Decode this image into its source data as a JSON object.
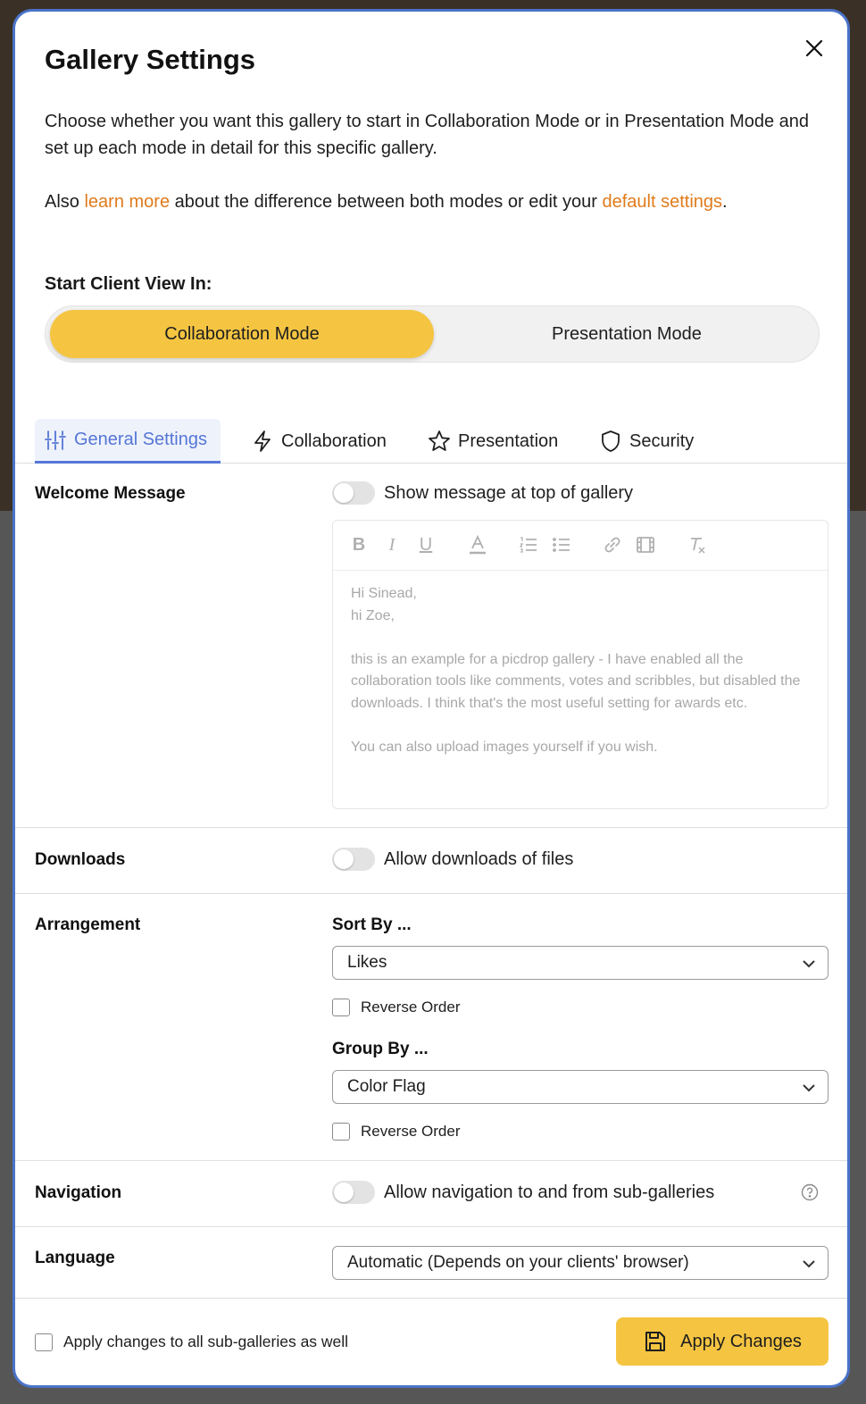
{
  "colors": {
    "accent": "#f5c542",
    "link": "#e07b1c",
    "tab_active": "#5576d6",
    "modal_border": "#4a73c9"
  },
  "modal": {
    "title": "Gallery Settings",
    "intro": "Choose whether you want this gallery to start in Collaboration Mode or in Presentation Mode and set up each mode in detail for this specific gallery.",
    "intro2_prefix": "Also ",
    "learn_more": "learn more",
    "intro2_middle": " about the difference between both modes or edit your ",
    "default_settings": "default settings",
    "intro2_suffix": "."
  },
  "start_view": {
    "label": "Start Client View In:",
    "options": [
      "Collaboration Mode",
      "Presentation Mode"
    ],
    "selected": "Collaboration Mode"
  },
  "tabs": [
    {
      "label": "General Settings",
      "icon": "sliders-icon",
      "active": true
    },
    {
      "label": "Collaboration",
      "icon": "lightning-icon",
      "active": false
    },
    {
      "label": "Presentation",
      "icon": "star-icon",
      "active": false
    },
    {
      "label": "Security",
      "icon": "shield-icon",
      "active": false
    }
  ],
  "welcome": {
    "label": "Welcome Message",
    "toggle_label": "Show message at top of gallery",
    "enabled": false,
    "toolbar": [
      "bold-icon",
      "italic-icon",
      "underline-icon",
      "text-color-icon",
      "ordered-list-icon",
      "bullet-list-icon",
      "link-icon",
      "video-icon",
      "clear-format-icon"
    ],
    "body": [
      "Hi Sinead,",
      "hi Zoe,",
      "",
      "this is an example for a picdrop gallery - I have enabled all the collaboration tools like comments, votes and scribbles, but disabled the downloads. I think that's the most useful setting for awards etc.",
      "",
      "You can also upload images yourself if you wish."
    ]
  },
  "downloads": {
    "label": "Downloads",
    "toggle_label": "Allow downloads of files",
    "enabled": false
  },
  "arrangement": {
    "label": "Arrangement",
    "sort_label": "Sort By ...",
    "sort_value": "Likes",
    "sort_reverse_label": "Reverse Order",
    "group_label": "Group By ...",
    "group_value": "Color Flag",
    "group_reverse_label": "Reverse Order"
  },
  "navigation": {
    "label": "Navigation",
    "toggle_label": "Allow navigation to and from sub-galleries",
    "enabled": false
  },
  "language": {
    "label": "Language",
    "value": "Automatic (Depends on your clients' browser)"
  },
  "footer": {
    "apply_all_label": "Apply changes to all sub-galleries as well",
    "apply_button": "Apply Changes"
  }
}
